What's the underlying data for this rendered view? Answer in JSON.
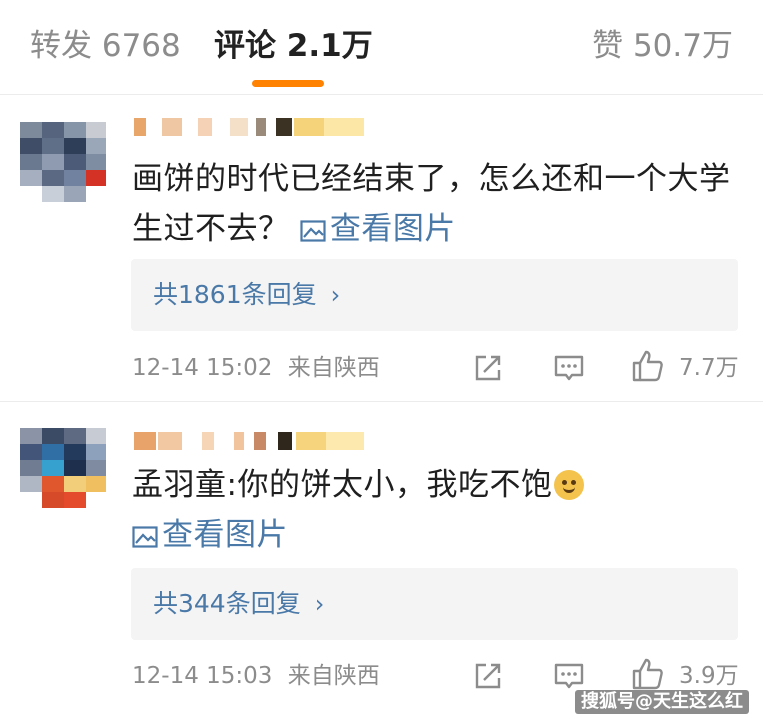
{
  "tabs": {
    "reposts": "转发 6768",
    "comments": "评论 2.1万",
    "likes": "赞 50.7万"
  },
  "accent_color": "#ff8200",
  "link_color": "#4a79a8",
  "comments": [
    {
      "text": "画饼的时代已经结束了，怎么还和一个大学生过不去？",
      "view_image_label": "查看图片",
      "replies_label": "共1861条回复",
      "timestamp": "12-14 15:02",
      "location": "来自陕西",
      "like_count": "7.7万",
      "icons": [
        "share-icon",
        "comment-icon",
        "thumbs-up-icon"
      ]
    },
    {
      "text": "孟羽童:你的饼太小，我吃不饱",
      "emoji": "doge-emoji",
      "view_image_label": "查看图片",
      "replies_label": "共344条回复",
      "timestamp": "12-14 15:03",
      "location": "来自陕西",
      "like_count": "3.9万",
      "icons": [
        "share-icon",
        "comment-icon",
        "thumbs-up-icon"
      ]
    }
  ],
  "watermark": "搜狐号@天生这么红"
}
